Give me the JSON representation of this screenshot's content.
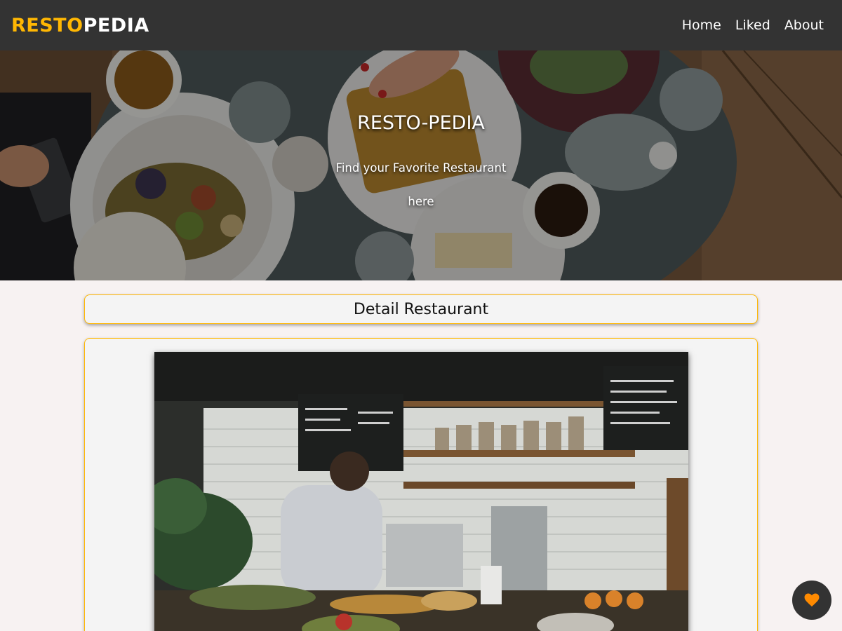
{
  "navbar": {
    "brand_accent": "RESTO",
    "brand_rest": "PEDIA",
    "links": [
      {
        "label": "Home"
      },
      {
        "label": "Liked"
      },
      {
        "label": "About"
      }
    ]
  },
  "hero": {
    "title": "RESTO-PEDIA",
    "tagline": "Find your Favorite Restaurant here"
  },
  "detail": {
    "heading": "Detail Restaurant"
  },
  "like_button": {
    "icon": "heart-icon",
    "state": "not-liked"
  },
  "colors": {
    "navbar": "#333333",
    "accent": "#ffb703",
    "page_background": "#f7f2f2",
    "card_background": "#f4f4f4",
    "heart": "#ff8a00"
  }
}
